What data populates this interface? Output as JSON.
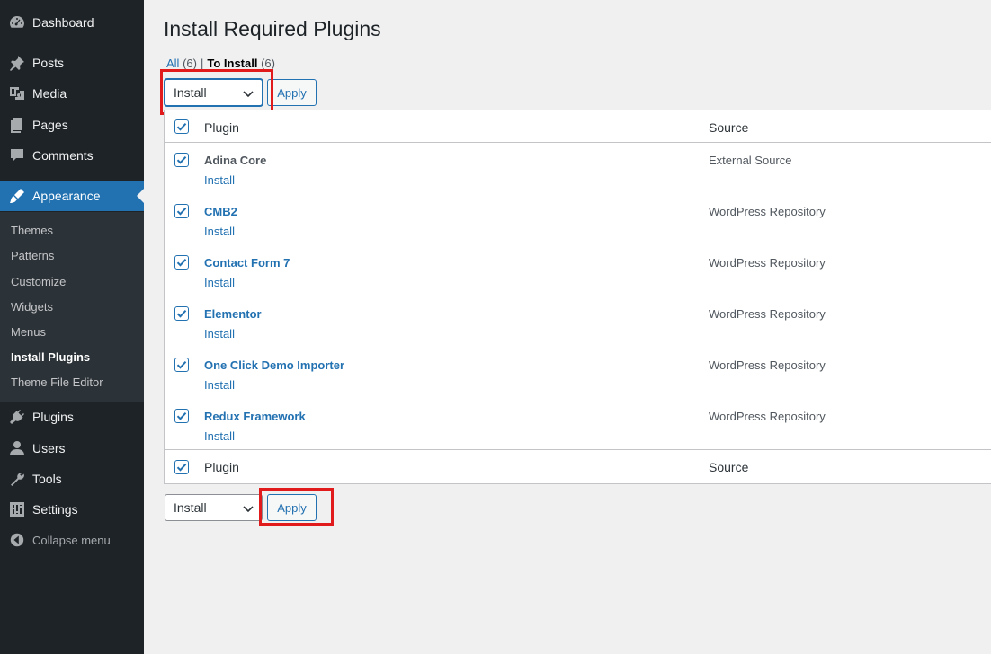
{
  "sidebar": {
    "items": [
      {
        "label": "Dashboard",
        "icon": "dashboard-icon"
      },
      {
        "label": "Posts",
        "icon": "pin-icon"
      },
      {
        "label": "Media",
        "icon": "media-icon"
      },
      {
        "label": "Pages",
        "icon": "pages-icon"
      },
      {
        "label": "Comments",
        "icon": "comment-icon"
      },
      {
        "label": "Appearance",
        "icon": "brush-icon"
      },
      {
        "label": "Plugins",
        "icon": "plug-icon"
      },
      {
        "label": "Users",
        "icon": "user-icon"
      },
      {
        "label": "Tools",
        "icon": "wrench-icon"
      },
      {
        "label": "Settings",
        "icon": "settings-icon"
      },
      {
        "label": "Collapse menu",
        "icon": "collapse-icon"
      }
    ],
    "submenu": [
      "Themes",
      "Patterns",
      "Customize",
      "Widgets",
      "Menus",
      "Install Plugins",
      "Theme File Editor"
    ],
    "active_item": "Appearance",
    "current_submenu": "Install Plugins"
  },
  "page": {
    "title": "Install Required Plugins",
    "filters": {
      "all_label": "All",
      "all_count": "(6)",
      "separator": "|",
      "to_install_label": "To Install",
      "to_install_count": "(6)"
    }
  },
  "bulk_actions": {
    "selected": "Install",
    "apply_label": "Apply"
  },
  "table": {
    "columns": [
      "Plugin",
      "Source"
    ],
    "rows": [
      {
        "plugin": "Adina Core",
        "action": "Install",
        "source": "External Source",
        "linked": false
      },
      {
        "plugin": "CMB2",
        "action": "Install",
        "source": "WordPress Repository",
        "linked": true
      },
      {
        "plugin": "Contact Form 7",
        "action": "Install",
        "source": "WordPress Repository",
        "linked": true
      },
      {
        "plugin": "Elementor",
        "action": "Install",
        "source": "WordPress Repository",
        "linked": true
      },
      {
        "plugin": "One Click Demo Importer",
        "action": "Install",
        "source": "WordPress Repository",
        "linked": true
      },
      {
        "plugin": "Redux Framework",
        "action": "Install",
        "source": "WordPress Repository",
        "linked": true
      }
    ]
  },
  "colors": {
    "accent": "#2271b1",
    "sidebar_bg": "#1d2327",
    "highlight": "#e11b1b"
  }
}
